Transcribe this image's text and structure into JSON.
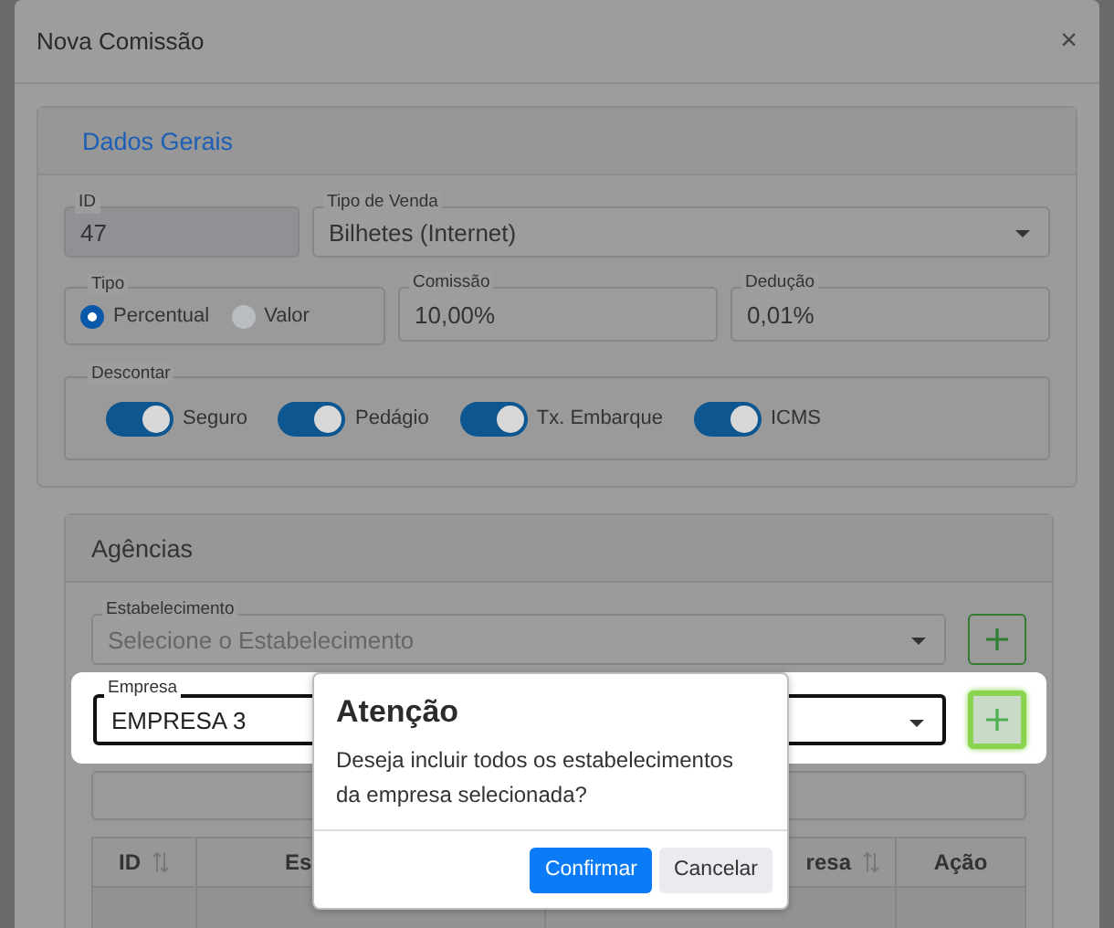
{
  "modal": {
    "title": "Nova Comissão",
    "close": "×"
  },
  "general": {
    "heading": "Dados Gerais",
    "id": {
      "label": "ID",
      "value": "47"
    },
    "sale_type": {
      "label": "Tipo de Venda",
      "value": "Bilhetes (Internet)"
    },
    "type": {
      "label": "Tipo",
      "options": [
        {
          "label": "Percentual",
          "selected": true
        },
        {
          "label": "Valor",
          "selected": false
        }
      ]
    },
    "commission": {
      "label": "Comissão",
      "value": "10,00%"
    },
    "deduction": {
      "label": "Dedução",
      "value": "0,01%"
    },
    "discount": {
      "label": "Descontar",
      "toggles": [
        {
          "label": "Seguro",
          "on": true
        },
        {
          "label": "Pedágio",
          "on": true
        },
        {
          "label": "Tx. Embarque",
          "on": true
        },
        {
          "label": "ICMS",
          "on": true
        }
      ]
    }
  },
  "agencies": {
    "heading": "Agências",
    "establishment": {
      "label": "Estabelecimento",
      "placeholder": "Selecione o Estabelecimento"
    },
    "company": {
      "label": "Empresa",
      "value": "EMPRESA 3"
    },
    "table": {
      "columns": [
        {
          "label": "ID",
          "sortable": true
        },
        {
          "label": "Es"
        },
        {
          "label": "resa",
          "sortable": true
        },
        {
          "label": "Ação",
          "sortable": false
        }
      ]
    }
  },
  "dialog": {
    "title": "Atenção",
    "message": "Deseja incluir todos os estabelecimentos da empresa selecionada?",
    "buttons": [
      {
        "label": "Confirmar",
        "kind": "primary"
      },
      {
        "label": "Cancelar",
        "kind": "secondary"
      }
    ]
  }
}
